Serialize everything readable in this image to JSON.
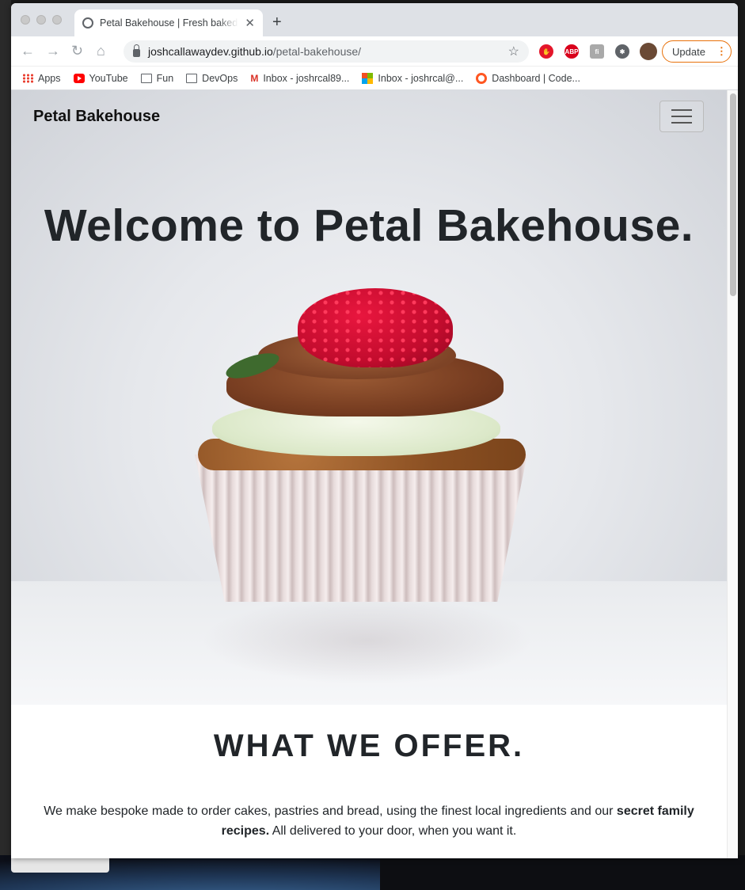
{
  "browser": {
    "tab_title": "Petal Bakehouse | Fresh baked",
    "new_tab_label": "+",
    "close_label": "✕",
    "url_domain": "joshcallawaydev.github.io",
    "url_path": "/petal-bakehouse/",
    "update_label": "Update",
    "update_menu": "⋮",
    "star_glyph": "☆",
    "extensions": [
      {
        "name": "stop-extension-icon",
        "color": "#e4162a",
        "text": "✋"
      },
      {
        "name": "adblock-plus-icon",
        "color": "#d9001b",
        "text": "ABP"
      },
      {
        "name": "gray-extension-icon",
        "color": "#a9a9a9",
        "text": "fi"
      },
      {
        "name": "puzzle-extension-icon",
        "color": "#5f6368",
        "text": "✱"
      },
      {
        "name": "profile-avatar",
        "color": "#6b4a35",
        "text": ""
      }
    ],
    "bookmarks": [
      {
        "label": "Apps",
        "icon": "apps-grid-icon"
      },
      {
        "label": "YouTube",
        "icon": "youtube-icon"
      },
      {
        "label": "Fun",
        "icon": "folder-icon"
      },
      {
        "label": "DevOps",
        "icon": "folder-icon"
      },
      {
        "label": "Inbox - joshrcal89...",
        "icon": "gmail-icon"
      },
      {
        "label": "Inbox - joshrcal@...",
        "icon": "microsoft-icon"
      },
      {
        "label": "Dashboard | Code...",
        "icon": "dashboard-icon"
      }
    ]
  },
  "site": {
    "brand": "Petal Bakehouse",
    "hero_title": "Welcome to Petal Bakehouse.",
    "offer_title": "WHAT WE OFFER.",
    "offer_text_1": "We make bespoke made to order cakes, pastries and bread, using the finest local ingredients and our ",
    "offer_text_bold": "secret family recipes.",
    "offer_text_2": " All delivered to your door, when you want it."
  }
}
